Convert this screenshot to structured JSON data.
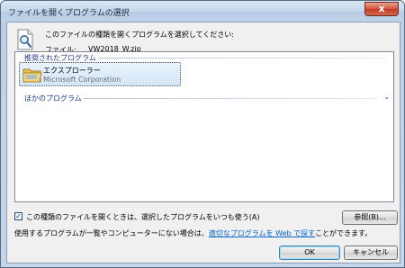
{
  "window": {
    "title": "ファイルを開くプログラムの選択",
    "close_label": "x"
  },
  "header": {
    "instruction": "このファイルの種類を開くプログラムを選択してください:",
    "file_label": "ファイル:",
    "file_name": "VW2018_W.zip"
  },
  "programs": {
    "recommended_header": "推奨されたプログラム",
    "items": [
      {
        "name": "エクスプローラー",
        "company": "Microsoft Corporation"
      }
    ],
    "other_header": "ほかのプログラム"
  },
  "options": {
    "always_use_label": "この種類のファイルを開くときは、選択したプログラムをいつも使う(A)",
    "always_use_checked": true
  },
  "buttons": {
    "browse": "参照(B)...",
    "ok": "OK",
    "cancel": "キャンセル"
  },
  "footer": {
    "text_before": "使用するプログラムが一覧やコンピューターにない場合は、",
    "link": "適切なプログラムを Web で探す",
    "text_after": "ことができます。"
  }
}
